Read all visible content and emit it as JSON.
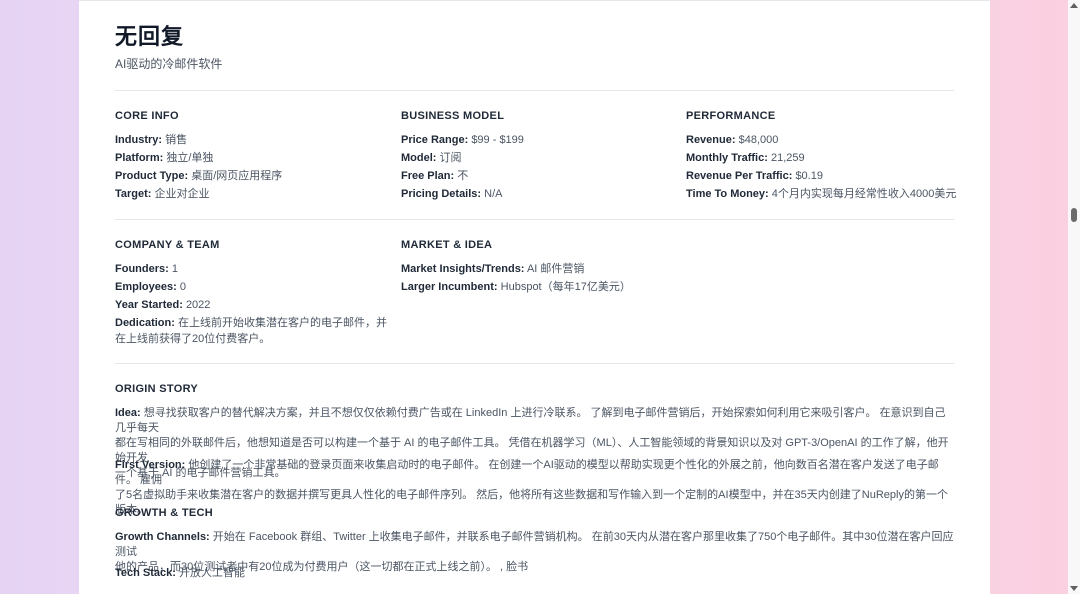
{
  "header": {
    "title": "无回复",
    "subtitle": "AI驱动的冷邮件软件"
  },
  "core_info": {
    "heading": "CORE INFO",
    "rows": [
      {
        "label": "Industry:",
        "value": "销售"
      },
      {
        "label": "Platform:",
        "value": "独立/单独"
      },
      {
        "label": "Product Type:",
        "value": "桌面/网页应用程序"
      },
      {
        "label": "Target:",
        "value": "企业对企业"
      }
    ]
  },
  "business_model": {
    "heading": "BUSINESS MODEL",
    "rows": [
      {
        "label": "Price Range:",
        "value": "$99 - $199"
      },
      {
        "label": "Model:",
        "value": "订阅"
      },
      {
        "label": "Free Plan:",
        "value": "不"
      },
      {
        "label": "Pricing Details:",
        "value": "N/A"
      }
    ]
  },
  "performance": {
    "heading": "PERFORMANCE",
    "rows": [
      {
        "label": "Revenue:",
        "value": "$48,000"
      },
      {
        "label": "Monthly Traffic:",
        "value": "21,259"
      },
      {
        "label": "Revenue Per Traffic:",
        "value": "$0.19"
      },
      {
        "label": "Time To Money:",
        "value": "4个月内实现每月经常性收入4000美元"
      }
    ]
  },
  "company_team": {
    "heading": "COMPANY & TEAM",
    "rows": [
      {
        "label": "Founders:",
        "value": "1"
      },
      {
        "label": "Employees:",
        "value": "0"
      },
      {
        "label": "Year Started:",
        "value": "2022"
      },
      {
        "label": "Dedication:",
        "value": "在上线前开始收集潜在客户的电子邮件，并",
        "value2": "在上线前获得了20位付费客户。"
      }
    ]
  },
  "market_idea": {
    "heading": "MARKET & IDEA",
    "rows": [
      {
        "label": "Market Insights/Trends:",
        "value": "AI 邮件营销"
      },
      {
        "label": "Larger Incumbent:",
        "value": "Hubspot（每年17亿美元）"
      }
    ]
  },
  "origin_story": {
    "heading": "ORIGIN STORY",
    "idea": {
      "label": "Idea:",
      "line1": "想寻找获取客户的替代解决方案，并且不想仅仅依赖付费广告或在 LinkedIn 上进行冷联系。 了解到电子邮件营销后，开始探索如何利用它来吸引客户。 在意识到自己几乎每天",
      "line2": "都在写相同的外联邮件后，他想知道是否可以构建一个基于 AI 的电子邮件工具。 凭借在机器学习（ML）、人工智能领域的背景知识以及对 GPT-3/OpenAI 的工作了解，他开始开发",
      "line3": "一个基于 AI 的电子邮件营销工具。"
    },
    "first_version": {
      "label": "First Version:",
      "line1": "他创建了一个非常基础的登录页面来收集启动时的电子邮件。 在创建一个AI驱动的模型以帮助实现更个性化的外展之前，他向数百名潜在客户发送了电子邮件。 雇佣",
      "line2": "了5名虚拟助手来收集潜在客户的数据并撰写更具人性化的电子邮件序列。 然后，他将所有这些数据和写作输入到一个定制的AI模型中，并在35天内创建了NuReply的第一个版本。"
    }
  },
  "growth_tech": {
    "heading": "GROWTH & TECH",
    "growth": {
      "label": "Growth Channels:",
      "line1": "开始在 Facebook 群组、Twitter 上收集电子邮件，并联系电子邮件营销机构。 在前30天内从潜在客户那里收集了750个电子邮件。其中30位潜在客户回应测试",
      "line2": "他的产品，而30位测试者中有20位成为付费用户（这一切都在正式上线之前）。 , 脸书"
    },
    "tech": {
      "label": "Tech Stack:",
      "value": "开放人工智能"
    }
  }
}
